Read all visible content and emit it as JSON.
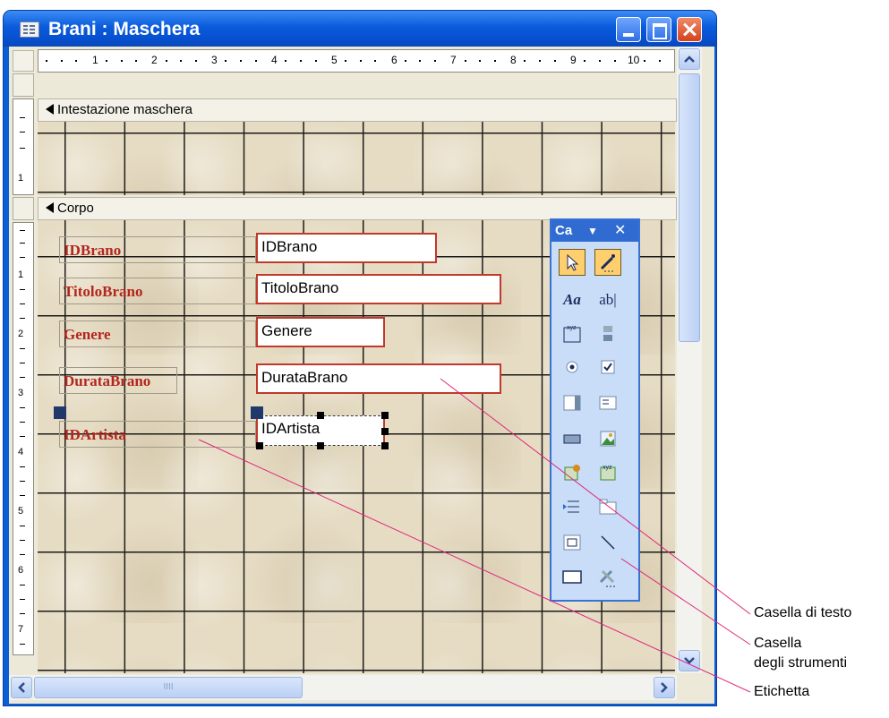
{
  "window": {
    "title": "Brani : Maschera"
  },
  "ruler": {
    "h_numbers": [
      "1",
      "2",
      "3",
      "4",
      "5",
      "6",
      "7",
      "8",
      "9",
      "10"
    ],
    "v_numbers": [
      "1",
      "1",
      "2",
      "3",
      "4",
      "5",
      "6",
      "7"
    ]
  },
  "sections": {
    "header": "Intestazione maschera",
    "body": "Corpo"
  },
  "fields": [
    {
      "label": "IDBrano",
      "box": "IDBrano"
    },
    {
      "label": "TitoloBrano",
      "box": "TitoloBrano"
    },
    {
      "label": "Genere",
      "box": "Genere"
    },
    {
      "label": "DurataBrano",
      "box": "DurataBrano"
    },
    {
      "label": "IDArtista",
      "box": "IDArtista"
    }
  ],
  "toolbox": {
    "title": "Ca",
    "dropdown": "▼",
    "close": "✕"
  },
  "scrollbar": {
    "grip": "IIII"
  },
  "annotations": {
    "textbox": "Casella di testo",
    "toolbox_line1": "Casella",
    "toolbox_line2": "degli strumenti",
    "label": "Etichetta"
  },
  "colors": {
    "title_blue": "#0a5bdc",
    "label_red": "#b3261e",
    "form_bg": "#e6dcc4"
  }
}
